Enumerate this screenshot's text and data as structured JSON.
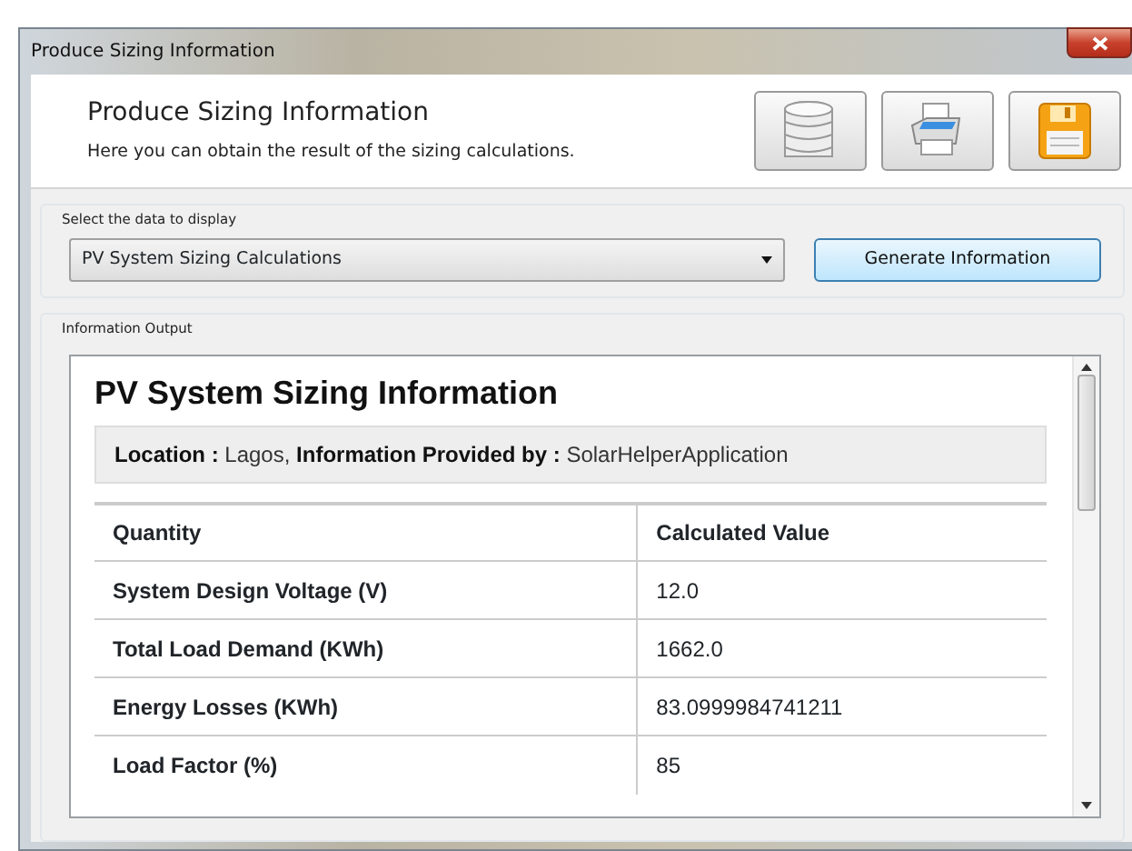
{
  "window": {
    "title": "Produce Sizing Information"
  },
  "header": {
    "title": "Produce Sizing Information",
    "subtitle": "Here you can obtain the result of the sizing calculations."
  },
  "toolbar": [
    {
      "kind": "database"
    },
    {
      "kind": "printer"
    },
    {
      "kind": "save"
    }
  ],
  "data_selection": {
    "label": "Select the data to display",
    "dropdown": {
      "value": "PV System Sizing Calculations"
    },
    "button": "Generate Information"
  },
  "output": {
    "label": "Information Output",
    "report": {
      "title": "PV System Sizing Information",
      "info": "**Location :** Lagos, **Information Provided by :** SolarHelperApplication",
      "table": {
        "columns": [
          "Quantity",
          "Calculated Value"
        ],
        "rows": [
          [
            "System Design Voltage (V)",
            "12.0"
          ],
          [
            "Total Load Demand (KWh)",
            "1662.0"
          ],
          [
            "Energy Losses (KWh)",
            "83.0999984741211"
          ],
          [
            "Load Factor (%)",
            "85"
          ]
        ]
      }
    }
  }
}
